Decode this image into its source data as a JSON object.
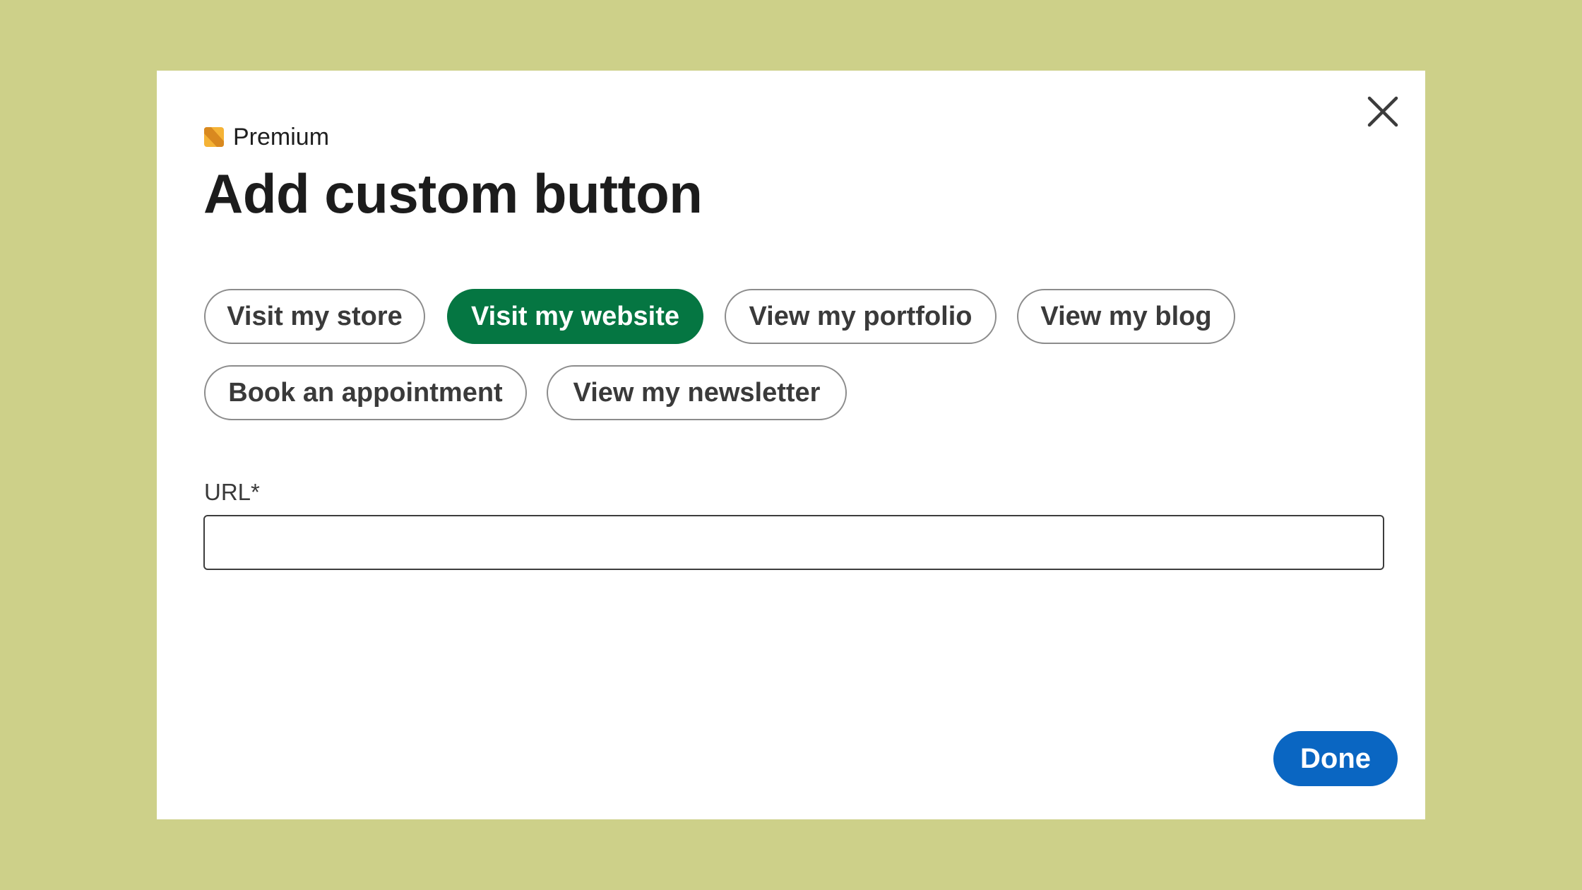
{
  "modal": {
    "premium_label": "Premium",
    "title": "Add custom button",
    "close_icon": "close-icon",
    "premium_icon": "premium-badge-icon"
  },
  "options": [
    {
      "label": "Visit my store",
      "selected": false
    },
    {
      "label": "Visit my website",
      "selected": true
    },
    {
      "label": "View my portfolio",
      "selected": false
    },
    {
      "label": "View my blog",
      "selected": false
    },
    {
      "label": "Book an appointment",
      "selected": false
    },
    {
      "label": "View my newsletter",
      "selected": false
    }
  ],
  "url_field": {
    "label": "URL*",
    "value": "",
    "placeholder": ""
  },
  "actions": {
    "done_label": "Done"
  },
  "colors": {
    "background": "#cdd089",
    "selected_option": "#057642",
    "primary_button": "#0a66c2",
    "premium_icon": "#e3a02b"
  }
}
